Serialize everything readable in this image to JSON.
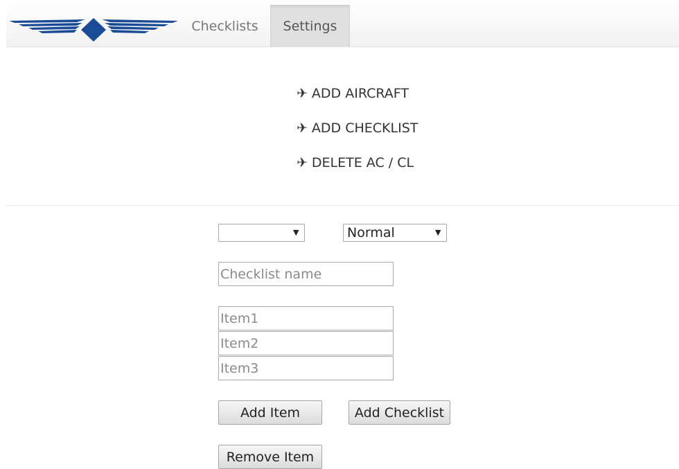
{
  "nav": {
    "tabs": [
      {
        "label": "Checklists"
      },
      {
        "label": "Settings"
      }
    ],
    "brand_color": "#1a4b96"
  },
  "menu": {
    "plane_glyph": "✈",
    "items": [
      {
        "label": "ADD AIRCRAFT"
      },
      {
        "label": "ADD CHECKLIST"
      },
      {
        "label": "DELETE AC / CL"
      }
    ]
  },
  "form": {
    "aircraft_select": {
      "value": ""
    },
    "type_select": {
      "value": "Normal",
      "arrow": "▼"
    },
    "checklist_name": {
      "placeholder": "Checklist name",
      "value": ""
    },
    "items": [
      {
        "placeholder": "Item1"
      },
      {
        "placeholder": "Item2"
      },
      {
        "placeholder": "Item3"
      }
    ],
    "add_item_label": "Add Item",
    "add_checklist_label": "Add Checklist",
    "remove_item_label": "Remove Item"
  }
}
